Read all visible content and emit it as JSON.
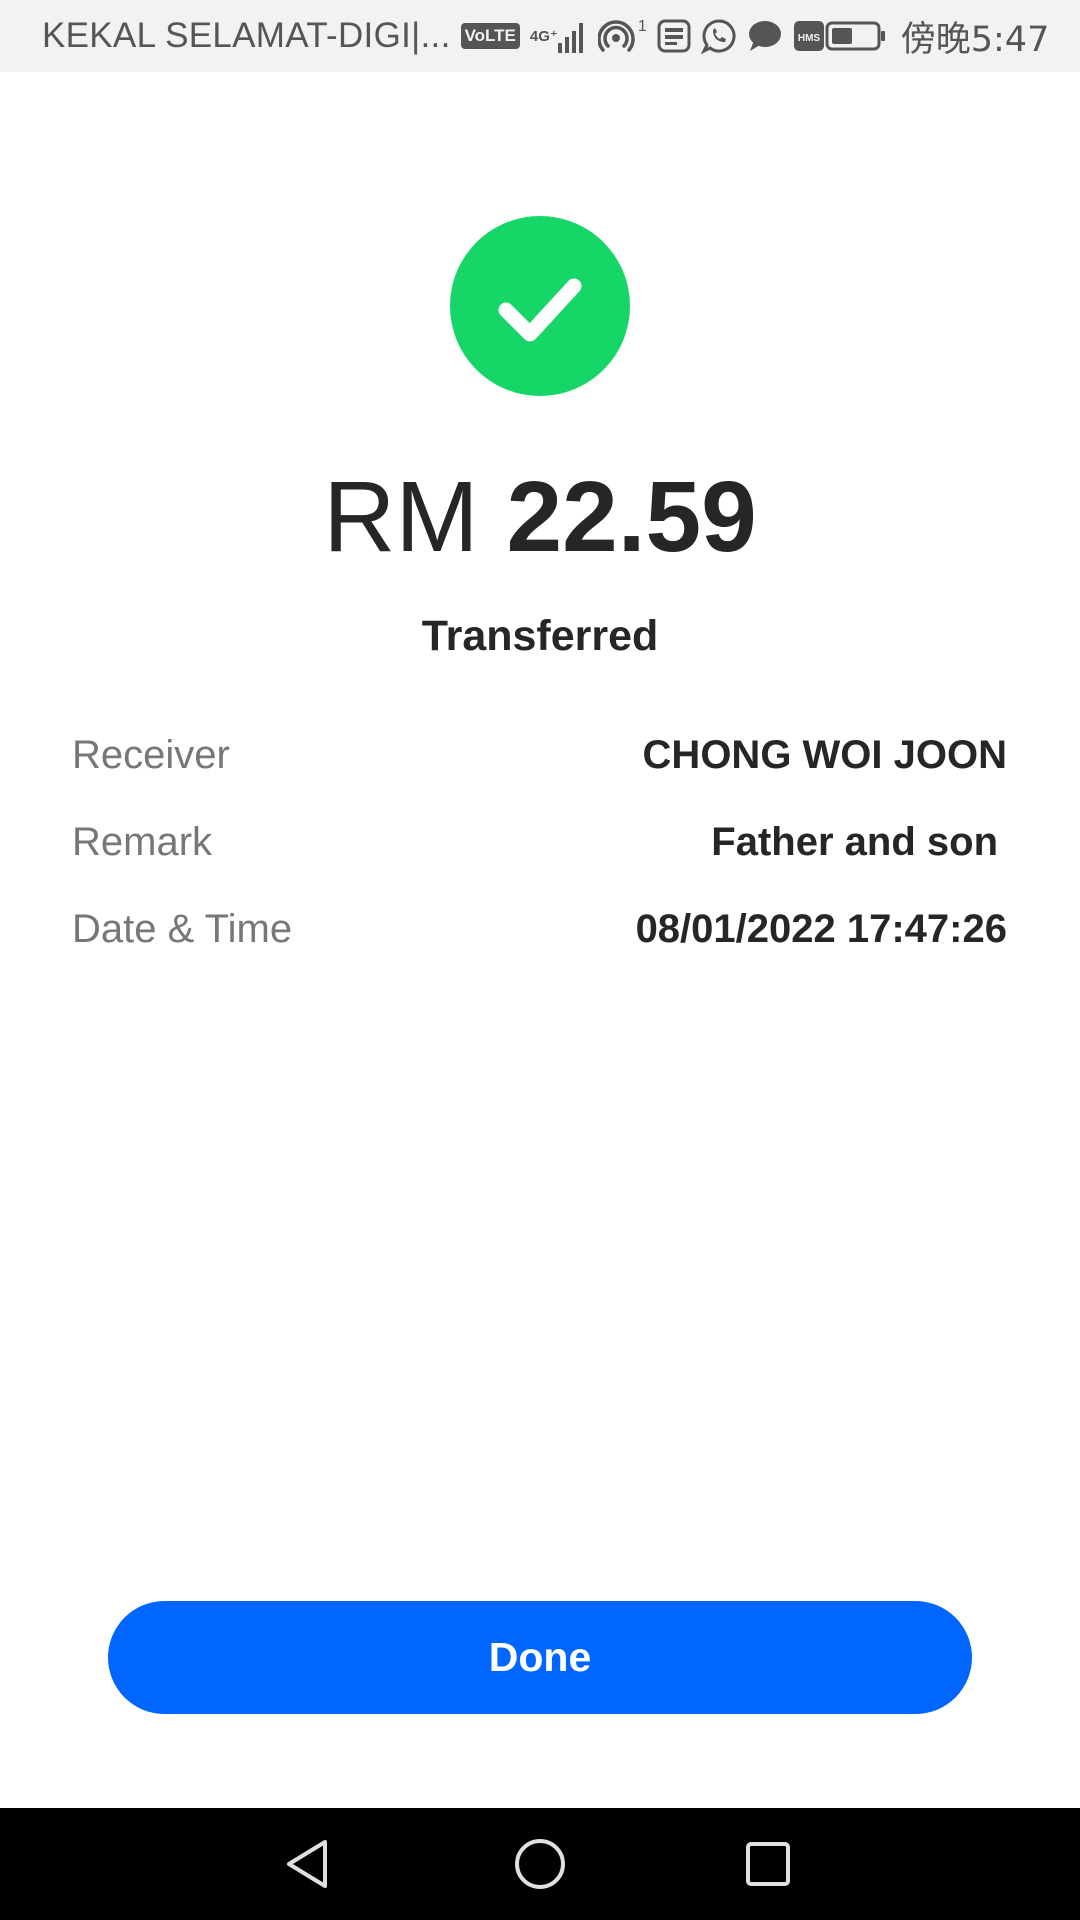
{
  "status_bar": {
    "carrier": "KEKAL SELAMAT-DIGI|...",
    "volte_label": "VoLTE",
    "network_label": "4G⁺",
    "hotspot_badge": "1",
    "clock": "傍晚5:47",
    "icons": [
      "volte-icon",
      "signal-icon",
      "hotspot-icon",
      "touch-n-go-icon",
      "whatsapp-icon",
      "message-icon",
      "hms-icon",
      "battery-icon"
    ]
  },
  "result": {
    "icon": "checkmark-icon",
    "currency": "RM",
    "amount": "22.59",
    "status": "Transferred"
  },
  "details": [
    {
      "label": "Receiver",
      "value": "CHONG WOI JOON"
    },
    {
      "label": "Remark",
      "value": "Father and son"
    },
    {
      "label": "Date & Time",
      "value": "08/01/2022 17:47:26"
    }
  ],
  "actions": {
    "done_label": "Done"
  },
  "navigation": {
    "icons": [
      "back-icon",
      "home-icon",
      "recents-icon"
    ]
  },
  "colors": {
    "success": "#16d667",
    "primary": "#0066ff",
    "text": "#262626",
    "muted": "#777777"
  }
}
